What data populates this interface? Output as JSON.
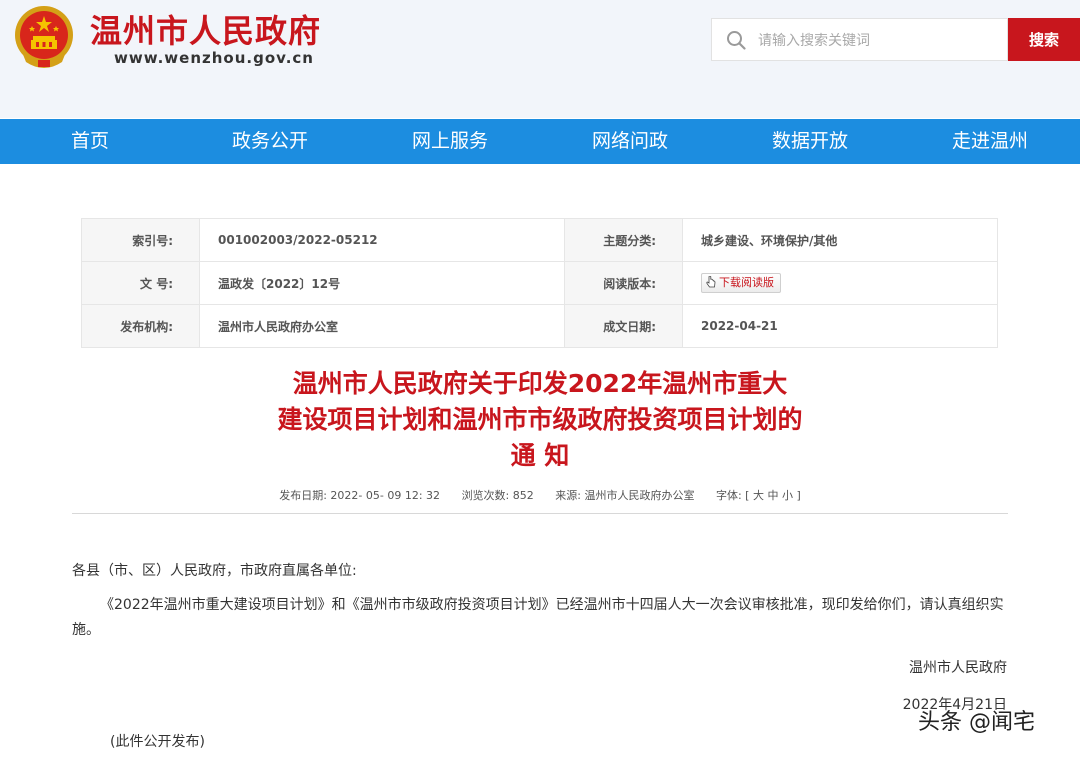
{
  "header": {
    "site_title": "温州市人民政府",
    "site_url": "www.wenzhou.gov.cn",
    "search_placeholder": "请输入搜索关键词",
    "search_button": "搜索"
  },
  "nav": [
    "首页",
    "政务公开",
    "网上服务",
    "网络问政",
    "数据开放",
    "走进温州"
  ],
  "meta": {
    "index_label": "索引号:",
    "index_value": "001002003/2022-05212",
    "topic_label": "主题分类:",
    "topic_value": "城乡建设、环境保护/其他",
    "docno_label": "文 号:",
    "docno_value": "温政发〔2022〕12号",
    "reading_label": "阅读版本:",
    "reading_button": "下载阅读版",
    "issuer_label": "发布机构:",
    "issuer_value": "温州市人民政府办公室",
    "date_label": "成文日期:",
    "date_value": "2022-04-21"
  },
  "article": {
    "title_lines": [
      "温州市人民政府关于印发2022年温州市重大",
      "建设项目计划和温州市市级政府投资项目计划的",
      "通 知"
    ],
    "publish_date": "发布日期: 2022- 05- 09 12: 32",
    "views": "浏览次数: 852",
    "source": "来源: 温州市人民政府办公室",
    "font_size": "字体: [ 大 中 小 ]",
    "salutation": "各县（市、区）人民政府，市政府直属各单位:",
    "paragraph": "《2022年温州市重大建设项目计划》和《温州市市级政府投资项目计划》已经温州市十四届人大一次会议审核批准，现印发给你们，请认真组织实施。",
    "signature": "温州市人民政府",
    "sign_date": "2022年4月21日",
    "note": "(此件公开发布)"
  },
  "watermark": "头条 @闻宅",
  "colors": {
    "brand_red": "#c8161d",
    "nav_blue": "#1c8de0",
    "header_bg": "#f2f5fa"
  },
  "icons": [
    "national-emblem-icon",
    "search-icon",
    "download-hand-icon"
  ]
}
